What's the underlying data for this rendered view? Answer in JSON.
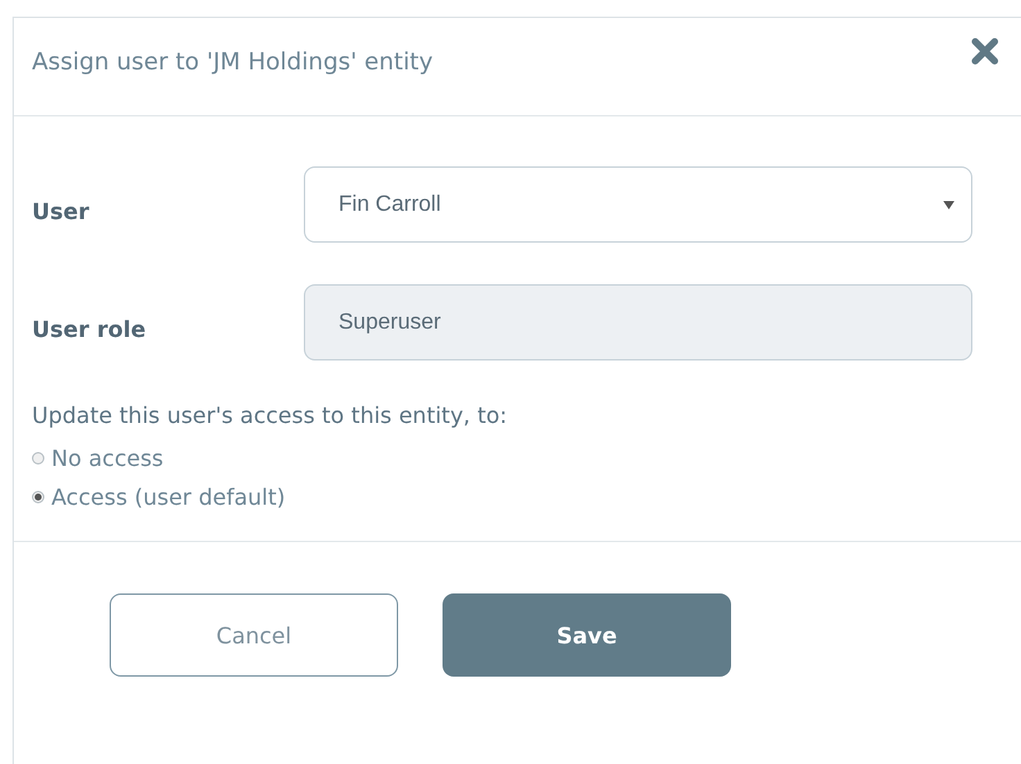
{
  "dialog": {
    "title": "Assign user to 'JM Holdings' entity"
  },
  "fields": [
    {
      "label": "User",
      "value": "Fin Carroll",
      "kind": "select"
    },
    {
      "label": "User role",
      "value": "Superuser",
      "kind": "readonly"
    }
  ],
  "access": {
    "heading": "Update this user's access to this entity, to:",
    "options": [
      {
        "label": "No access",
        "selected": false
      },
      {
        "label": "Access (user default)",
        "selected": true
      }
    ]
  },
  "buttons": [
    {
      "label": "Cancel",
      "kind": "secondary"
    },
    {
      "label": "Save",
      "kind": "primary"
    }
  ]
}
